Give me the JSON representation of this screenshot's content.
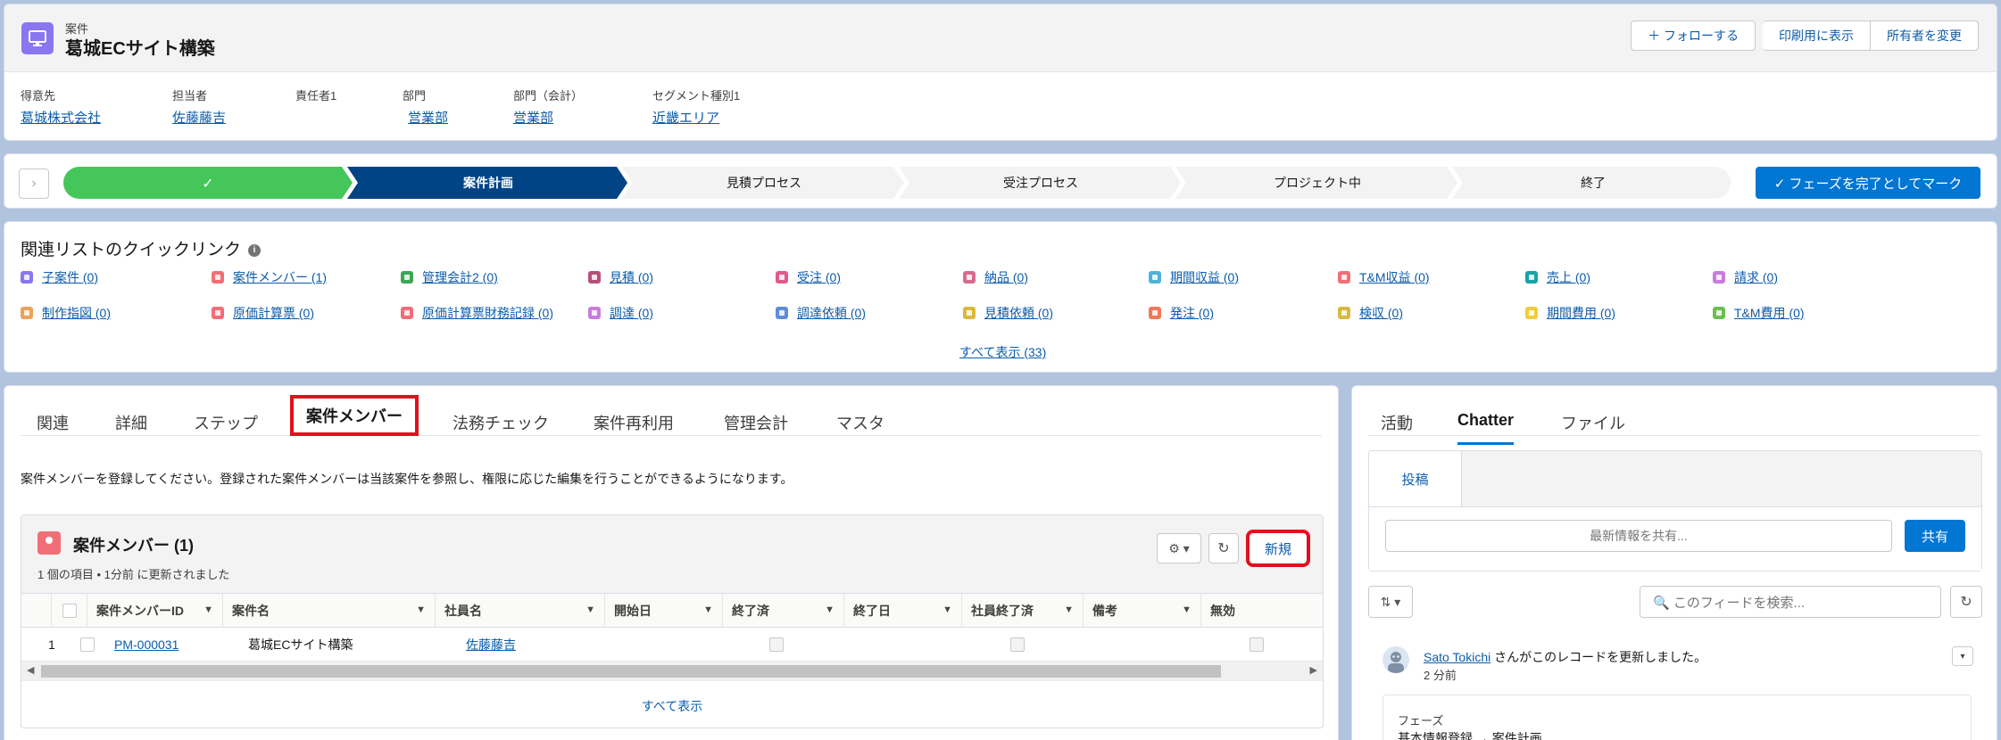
{
  "header": {
    "object_label": "案件",
    "title": "葛城ECサイト構築",
    "buttons": {
      "follow": "＋ フォローする",
      "print": "印刷用に表示",
      "change_owner": "所有者を変更"
    },
    "fields": [
      {
        "label": "得意先",
        "value": "葛城株式会社"
      },
      {
        "label": "担当者",
        "value": "佐藤藤吉"
      },
      {
        "label": "責任者1",
        "value": ""
      },
      {
        "label": "部門",
        "value": "営業部"
      },
      {
        "label": "部門（会計）",
        "value": "営業部"
      },
      {
        "label": "セグメント種別1",
        "value": "近畿エリア"
      }
    ]
  },
  "path": {
    "toggle": "›",
    "complete_check": "✓",
    "stages": [
      "案件計画",
      "見積プロセス",
      "受注プロセス",
      "プロジェクト中",
      "終了"
    ],
    "mark_button": "✓ フェーズを完了としてマーク"
  },
  "quick_links": {
    "title": "関連リストのクイックリンク",
    "info": "i",
    "row1": [
      {
        "label": "子案件 (0)",
        "color": "#8a76f0"
      },
      {
        "label": "案件メンバー (1)",
        "color": "#f06f76"
      },
      {
        "label": "管理会計2 (0)",
        "color": "#3ba755"
      },
      {
        "label": "見積 (0)",
        "color": "#b5507b"
      },
      {
        "label": "受注 (0)",
        "color": "#e2598e"
      },
      {
        "label": "納品 (0)",
        "color": "#d66c8e"
      },
      {
        "label": "期間収益 (0)",
        "color": "#4fb2d9"
      },
      {
        "label": "T&M収益 (0)",
        "color": "#f06f76"
      },
      {
        "label": "売上 (0)",
        "color": "#18a3a3"
      },
      {
        "label": "請求 (0)",
        "color": "#c77ddb"
      }
    ],
    "row2": [
      {
        "label": "制作指図 (0)",
        "color": "#e9a35b"
      },
      {
        "label": "原価計算票 (0)",
        "color": "#f06f76"
      },
      {
        "label": "原価計算票財務記録 (0)",
        "color": "#f06f76"
      },
      {
        "label": "調達 (0)",
        "color": "#c77ddb"
      },
      {
        "label": "調達依頼 (0)",
        "color": "#5e8ed8"
      },
      {
        "label": "見積依頼 (0)",
        "color": "#d9b83f"
      },
      {
        "label": "発注 (0)",
        "color": "#ef7a5b"
      },
      {
        "label": "検収 (0)",
        "color": "#d9b83f"
      },
      {
        "label": "期間費用 (0)",
        "color": "#f2cc3c"
      },
      {
        "label": "T&M費用 (0)",
        "color": "#6cbf4f"
      }
    ],
    "view_all": "すべて表示 (33)"
  },
  "main": {
    "tabs": [
      "関連",
      "詳細",
      "ステップ",
      "案件メンバー",
      "法務チェック",
      "案件再利用",
      "管理会計",
      "マスタ"
    ],
    "description": "案件メンバーを登録してください。登録された案件メンバーは当該案件を参照し、権限に応じた編集を行うことができるようになります。",
    "related_list": {
      "title": "案件メンバー (1)",
      "subtitle": "1 個の項目 • 1分前 に更新されました",
      "gear": "⚙ ▾",
      "refresh": "↻",
      "new_button": "新規",
      "columns": [
        "案件メンバーID",
        "案件名",
        "社員名",
        "開始日",
        "終了済",
        "終了日",
        "社員終了済",
        "備考",
        "無効"
      ],
      "rows": [
        {
          "num": "1",
          "id": "PM-000031",
          "opp": "葛城ECサイト構築",
          "employee": "佐藤藤吉"
        }
      ],
      "view_all": "すべて表示"
    }
  },
  "side": {
    "tabs": [
      "活動",
      "Chatter",
      "ファイル"
    ],
    "publisher": {
      "tab": "投稿",
      "placeholder": "最新情報を共有...",
      "share": "共有"
    },
    "sort": "⇅ ▾",
    "search_placeholder": "🔍 このフィードを検索...",
    "refresh": "↻",
    "feed": {
      "user": "Sato Tokichi",
      "action": " さんがこのレコードを更新しました。",
      "time": "2 分前",
      "dropdown": "▾",
      "field_label": "フェーズ",
      "field_value": "基本情報登録 → 案件計画"
    }
  }
}
